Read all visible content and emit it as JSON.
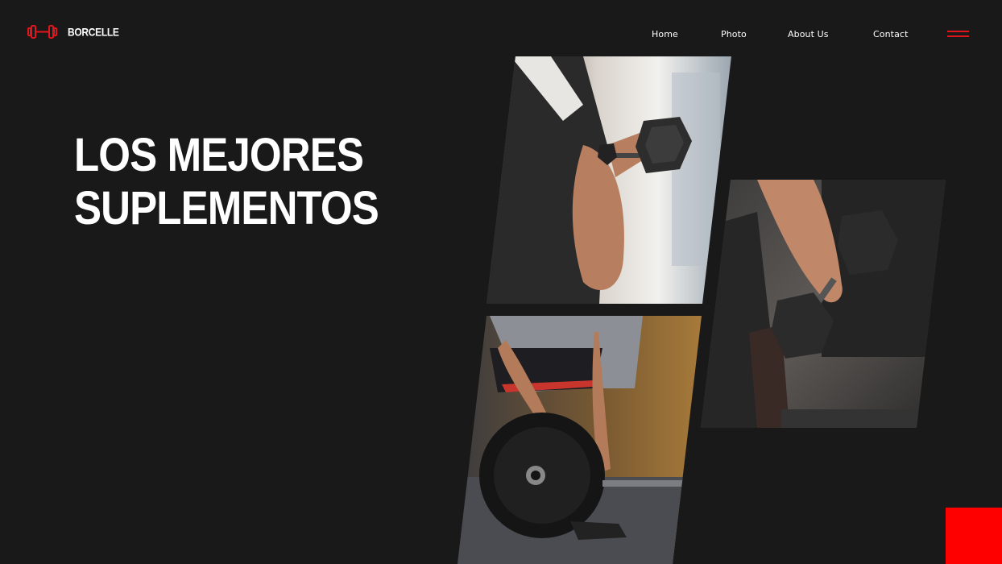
{
  "brand": {
    "name": "BORCELLE",
    "logo_icon": "dumbbell-icon",
    "accent": "#e0161c"
  },
  "nav": {
    "items": [
      {
        "label": "Home"
      },
      {
        "label": "Photo"
      },
      {
        "label": "About Us"
      },
      {
        "label": "Contact"
      }
    ],
    "menu_icon": "hamburger-menu-icon"
  },
  "hero": {
    "line1": "LOS MEJORES",
    "line2": "SUPLEMENTOS"
  },
  "colors": {
    "background": "#1a1919",
    "corner_block": "#ff0000",
    "text": "#ffffff"
  }
}
